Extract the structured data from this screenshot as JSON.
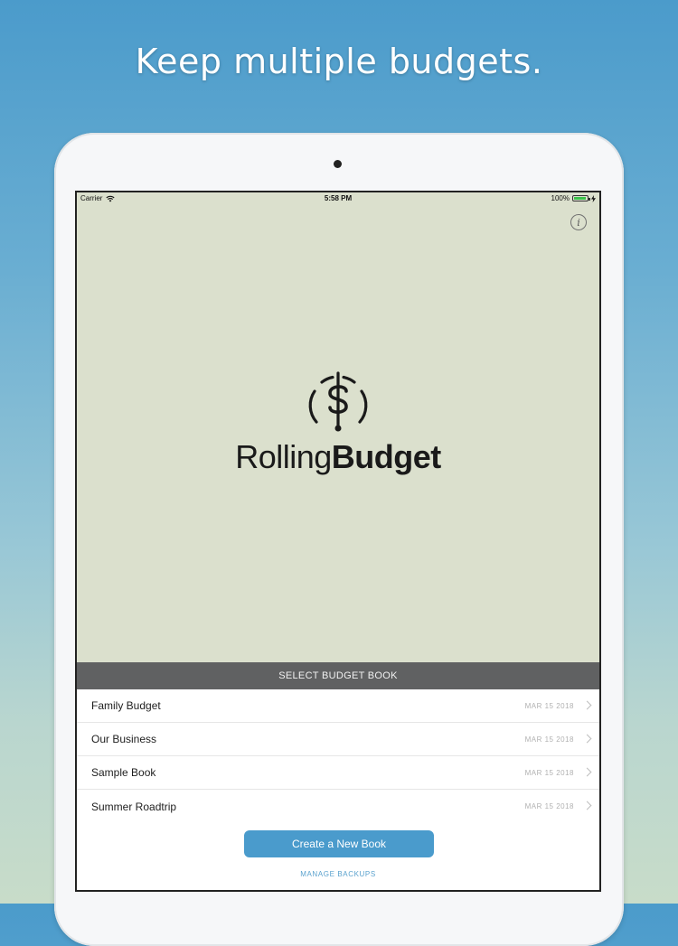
{
  "headline": "Keep multiple budgets.",
  "status_bar": {
    "carrier": "Carrier",
    "time": "5:58 PM",
    "battery_percent": "100%",
    "battery_level": 1.0
  },
  "logo": {
    "text_light": "Rolling",
    "text_bold": "Budget",
    "icon": "dollar-gauge-icon"
  },
  "info_button": {
    "label": "i",
    "icon": "info-icon"
  },
  "section_header": "SELECT BUDGET BOOK",
  "books": [
    {
      "name": "Family Budget",
      "date": "MAR 15 2018"
    },
    {
      "name": "Our Business",
      "date": "MAR 15 2018"
    },
    {
      "name": "Sample Book",
      "date": "MAR 15 2018"
    },
    {
      "name": "Summer Roadtrip",
      "date": "MAR 15 2018"
    }
  ],
  "actions": {
    "create_label": "Create a New Book",
    "manage_label": "MANAGE BACKUPS"
  },
  "colors": {
    "screen_bg": "#dbe0cd",
    "header_bg": "#606162",
    "accent": "#4a9bcc",
    "battery": "#3bc24b"
  }
}
